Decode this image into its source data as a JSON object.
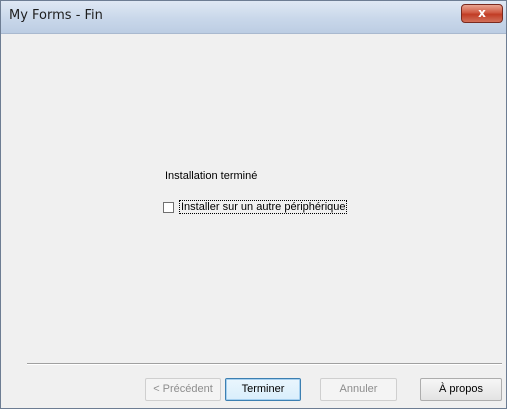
{
  "window": {
    "title": "My Forms - Fin",
    "close_glyph": "x"
  },
  "content": {
    "status_text": "Installation terminé",
    "checkbox_label": "Installer sur un autre périphérique",
    "checkbox_checked": false
  },
  "buttons": {
    "back_label": "< Précédent",
    "finish_label": "Terminer",
    "cancel_label": "Annuler",
    "about_label": "À propos"
  },
  "colors": {
    "window_bg": "#f0f0f0",
    "close_button": "#c13d25",
    "disabled_text": "#8d8d8d",
    "default_button_border": "#3c7fb1"
  },
  "icons": {
    "close": "close-icon"
  }
}
